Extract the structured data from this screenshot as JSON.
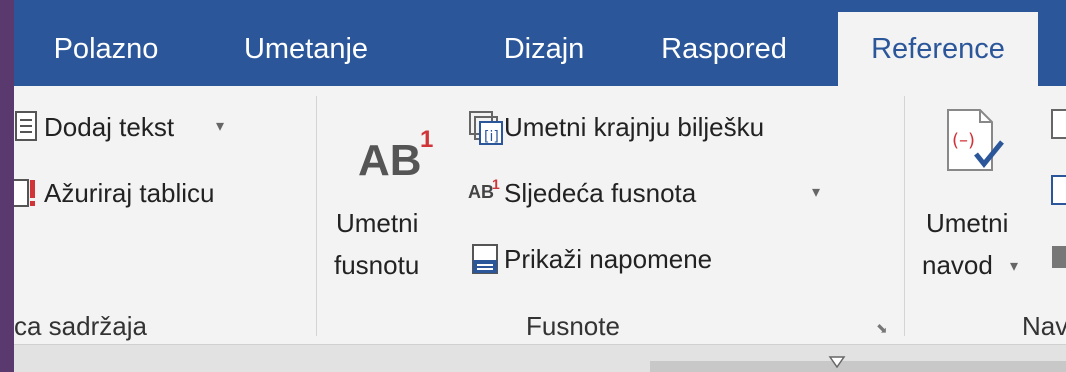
{
  "tabs": [
    {
      "label": "Polazno"
    },
    {
      "label": "Umetanje"
    },
    {
      "label": "Dizajn"
    },
    {
      "label": "Raspored"
    },
    {
      "label": "Reference"
    }
  ],
  "active_tab": "Reference",
  "colors": {
    "tabbar": "#2b579a",
    "ribbon": "#f3f3f3",
    "accent_red": "#d13438",
    "accent_blue": "#2b579a"
  },
  "toc_group": {
    "add_text": "Dodaj tekst",
    "update_table": "Ažuriraj tablicu",
    "label": "ca sadržaja"
  },
  "footnotes_group": {
    "insert_footnote_icon_text": "AB",
    "insert_footnote_icon_sup": "1",
    "insert_footnote_line1": "Umetni",
    "insert_footnote_line2": "fusnotu",
    "insert_endnote": "Umetni krajnju bilješku",
    "next_footnote_icon_text": "AB",
    "next_footnote_icon_sup": "1",
    "next_footnote": "Sljedeća fusnota",
    "show_notes": "Prikaži napomene",
    "label": "Fusnote"
  },
  "citations_group": {
    "insert_citation_icon_text": "(–)",
    "insert_citation_line1": "Umetni",
    "insert_citation_line2": "navod",
    "label": "Nav"
  }
}
